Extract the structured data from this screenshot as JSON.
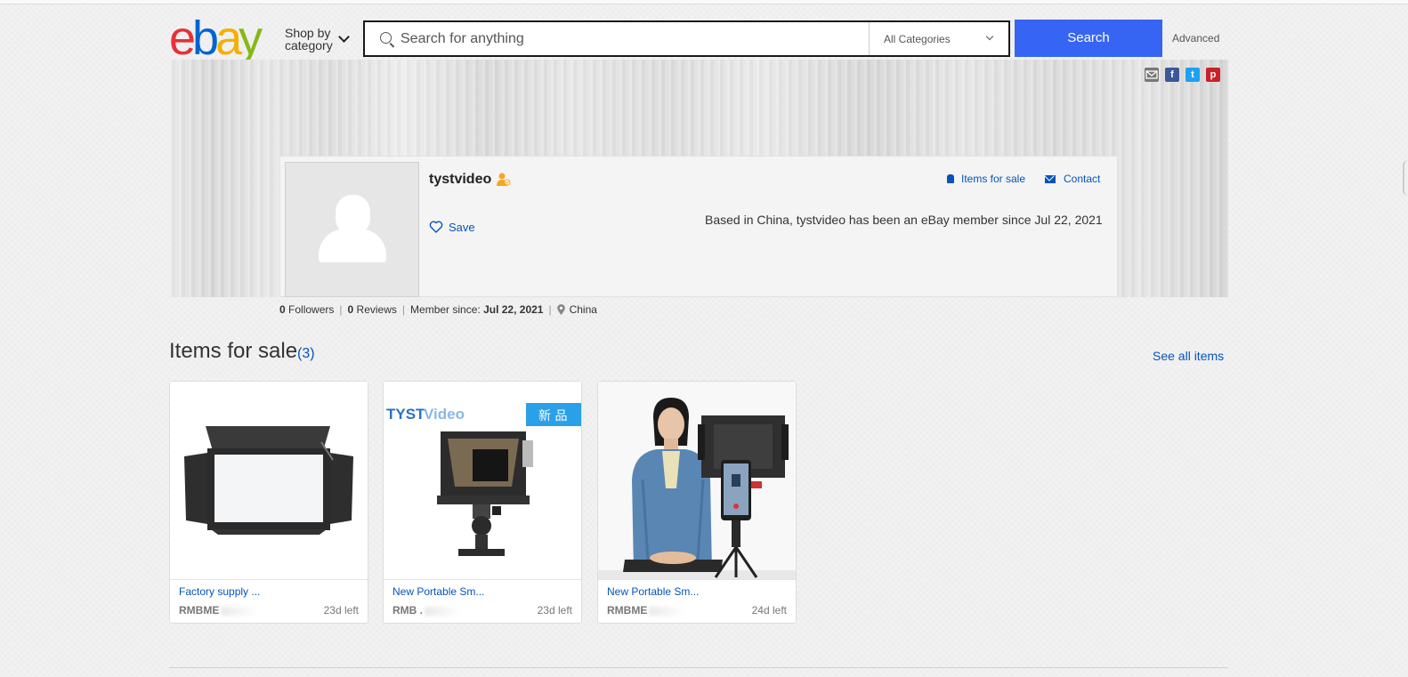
{
  "header": {
    "logo_letters": [
      "e",
      "b",
      "a",
      "y"
    ],
    "shop_by_line1": "Shop by",
    "shop_by_line2": "category",
    "search_placeholder": "Search for anything",
    "category_selected": "All Categories",
    "search_button": "Search",
    "advanced_link": "Advanced"
  },
  "share_icons": [
    "email-icon",
    "facebook-icon",
    "twitter-icon",
    "pinterest-icon"
  ],
  "share_icon_letters": {
    "facebook": "f",
    "twitter": "t",
    "pinterest": "p"
  },
  "profile": {
    "username": "tystvideo",
    "save_label": "Save",
    "items_for_sale_link": "Items for sale",
    "contact_link": "Contact",
    "based_text": "Based in China, tystvideo has been an eBay member since Jul 22, 2021"
  },
  "stats": {
    "followers_count": "0",
    "followers_label": "Followers",
    "reviews_count": "0",
    "reviews_label": "Reviews",
    "member_since_label": "Member since:",
    "member_since_value": "Jul 22, 2021",
    "location": "China"
  },
  "items_section": {
    "heading": "Items for sale",
    "count": "(3)",
    "see_all": "See all items"
  },
  "items": [
    {
      "title": "Factory supply ...",
      "price": "RMBME",
      "time_left": "23d left"
    },
    {
      "title": "New Portable Sm...",
      "price": "RMB .",
      "time_left": "23d left",
      "image_brand_a": "TYST",
      "image_brand_b": "Video",
      "image_badge": "新 品"
    },
    {
      "title": "New Portable Sm...",
      "price": "RMBME",
      "time_left": "24d left"
    }
  ],
  "colors": {
    "ebay_red": "#e53238",
    "ebay_blue": "#0064d2",
    "ebay_yellow": "#f5af02",
    "ebay_green": "#86b817",
    "search_button": "#3665f3",
    "link_blue": "#0654ba"
  }
}
